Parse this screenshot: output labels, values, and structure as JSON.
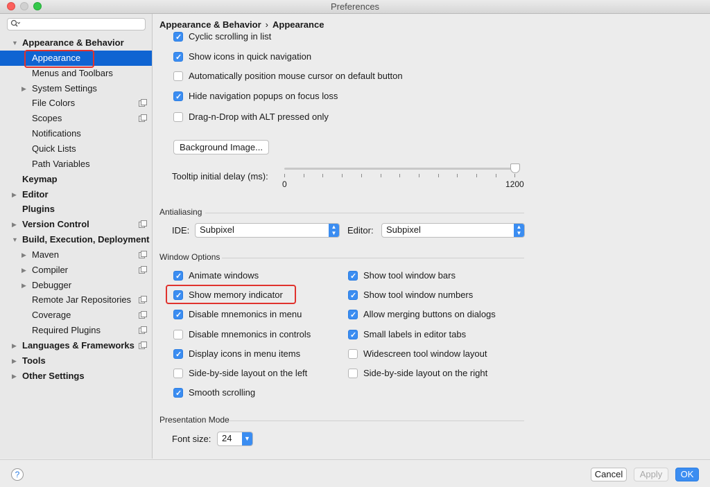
{
  "window": {
    "title": "Preferences"
  },
  "sidebar": {
    "search_placeholder": "",
    "items": [
      {
        "label": "Appearance & Behavior",
        "bold": true,
        "arrow": "▼",
        "level": 0
      },
      {
        "label": "Appearance",
        "selected": true,
        "level": 1
      },
      {
        "label": "Menus and Toolbars",
        "level": 1
      },
      {
        "label": "System Settings",
        "arrow": "▶",
        "level": 1
      },
      {
        "label": "File Colors",
        "level": 1,
        "project_icon": true
      },
      {
        "label": "Scopes",
        "level": 1,
        "project_icon": true
      },
      {
        "label": "Notifications",
        "level": 1
      },
      {
        "label": "Quick Lists",
        "level": 1
      },
      {
        "label": "Path Variables",
        "level": 1
      },
      {
        "label": "Keymap",
        "bold": true,
        "level": 0
      },
      {
        "label": "Editor",
        "bold": true,
        "arrow": "▶",
        "level": 0
      },
      {
        "label": "Plugins",
        "bold": true,
        "level": 0
      },
      {
        "label": "Version Control",
        "bold": true,
        "arrow": "▶",
        "level": 0,
        "project_icon": true
      },
      {
        "label": "Build, Execution, Deployment",
        "bold": true,
        "arrow": "▼",
        "level": 0
      },
      {
        "label": "Maven",
        "arrow": "▶",
        "level": 1,
        "project_icon": true
      },
      {
        "label": "Compiler",
        "arrow": "▶",
        "level": 1,
        "project_icon": true
      },
      {
        "label": "Debugger",
        "arrow": "▶",
        "level": 1
      },
      {
        "label": "Remote Jar Repositories",
        "level": 1,
        "project_icon": true
      },
      {
        "label": "Coverage",
        "level": 1,
        "project_icon": true
      },
      {
        "label": "Required Plugins",
        "level": 1,
        "project_icon": true
      },
      {
        "label": "Languages & Frameworks",
        "bold": true,
        "arrow": "▶",
        "level": 0,
        "project_icon": true
      },
      {
        "label": "Tools",
        "bold": true,
        "arrow": "▶",
        "level": 0
      },
      {
        "label": "Other Settings",
        "bold": true,
        "arrow": "▶",
        "level": 0
      }
    ]
  },
  "breadcrumb": {
    "parent": "Appearance & Behavior",
    "separator": "›",
    "current": "Appearance"
  },
  "ui_options": [
    {
      "label": "Cyclic scrolling in list",
      "checked": true
    },
    {
      "label": "Show icons in quick navigation",
      "checked": true
    },
    {
      "label": "Automatically position mouse cursor on default button",
      "checked": false
    },
    {
      "label": "Hide navigation popups on focus loss",
      "checked": true
    },
    {
      "label": "Drag-n-Drop with ALT pressed only",
      "checked": false
    }
  ],
  "background_image_button": "Background Image...",
  "tooltip": {
    "label": "Tooltip initial delay (ms):",
    "min": "0",
    "max": "1200",
    "value": 1200
  },
  "antialiasing": {
    "title": "Antialiasing",
    "ide_label": "IDE:",
    "ide_value": "Subpixel",
    "editor_label": "Editor:",
    "editor_value": "Subpixel"
  },
  "window_options": {
    "title": "Window Options",
    "left": [
      {
        "label": "Animate windows",
        "checked": true
      },
      {
        "label": "Show memory indicator",
        "checked": true,
        "highlighted": true
      },
      {
        "label": "Disable mnemonics in menu",
        "checked": true
      },
      {
        "label": "Disable mnemonics in controls",
        "checked": false
      },
      {
        "label": "Display icons in menu items",
        "checked": true
      },
      {
        "label": "Side-by-side layout on the left",
        "checked": false
      },
      {
        "label": "Smooth scrolling",
        "checked": true
      }
    ],
    "right": [
      {
        "label": "Show tool window bars",
        "checked": true
      },
      {
        "label": "Show tool window numbers",
        "checked": true
      },
      {
        "label": "Allow merging buttons on dialogs",
        "checked": true
      },
      {
        "label": "Small labels in editor tabs",
        "checked": true
      },
      {
        "label": "Widescreen tool window layout",
        "checked": false
      },
      {
        "label": "Side-by-side layout on the right",
        "checked": false
      }
    ]
  },
  "presentation": {
    "title": "Presentation Mode",
    "font_size_label": "Font size:",
    "font_size_value": "24"
  },
  "footer": {
    "help": "?",
    "cancel": "Cancel",
    "apply": "Apply",
    "ok": "OK"
  },
  "colors": {
    "accent": "#3b8df1",
    "selection": "#0f64d2",
    "highlight_box": "#e0322d"
  }
}
